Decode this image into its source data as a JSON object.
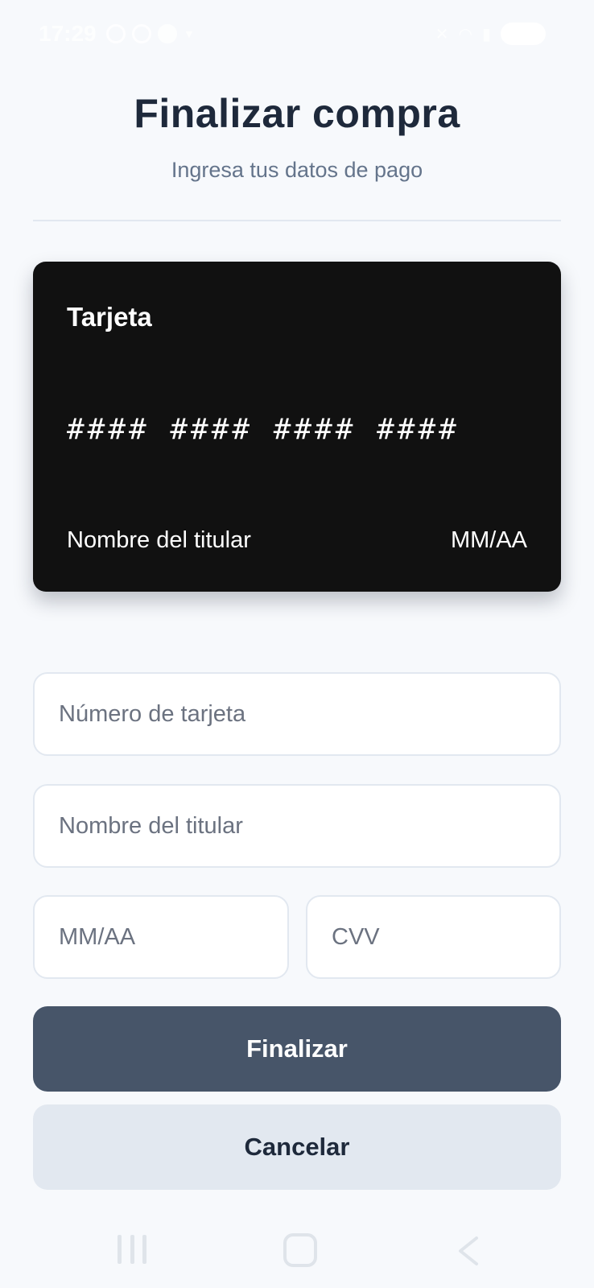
{
  "status_bar": {
    "time": "17:29"
  },
  "header": {
    "title": "Finalizar compra",
    "subtitle": "Ingresa tus datos de pago"
  },
  "card_preview": {
    "label": "Tarjeta",
    "number": "#### #### #### ####",
    "holder": "Nombre del titular",
    "expiry": "MM/AA"
  },
  "form": {
    "card_number_placeholder": "Número de tarjeta",
    "holder_placeholder": "Nombre del titular",
    "expiry_placeholder": "MM/AA",
    "cvv_placeholder": "CVV"
  },
  "actions": {
    "submit_label": "Finalizar",
    "cancel_label": "Cancelar"
  },
  "colors": {
    "background": "#f7f9fc",
    "card": "#111111",
    "primary_button": "#475569",
    "secondary_button": "#e2e8f0",
    "title": "#1e293b",
    "subtitle": "#64748b"
  },
  "icons": {
    "nav_recent": "recent-apps-icon",
    "nav_home": "home-icon",
    "nav_back": "back-icon"
  }
}
